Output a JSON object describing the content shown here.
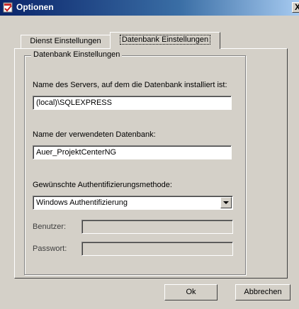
{
  "window": {
    "title": "Optionen",
    "close_glyph": "X"
  },
  "tabs": [
    {
      "label": "Dienst Einstellungen"
    },
    {
      "label": "Datenbank Einstellungen"
    }
  ],
  "group": {
    "title": "Datenbank Einstellungen",
    "server_label": "Name des Servers, auf dem die Datenbank installiert ist:",
    "server_value": "(local)\\SQLEXPRESS",
    "database_label": "Name der verwendeten Datenbank:",
    "database_value": "Auer_ProjektCenterNG",
    "auth_label": "Gewünschte Authentifizierungsmethode:",
    "auth_value": "Windows Authentifizierung",
    "user_label": "Benutzer:",
    "password_label": "Passwort:"
  },
  "buttons": {
    "ok": "Ok",
    "cancel": "Abbrechen"
  }
}
